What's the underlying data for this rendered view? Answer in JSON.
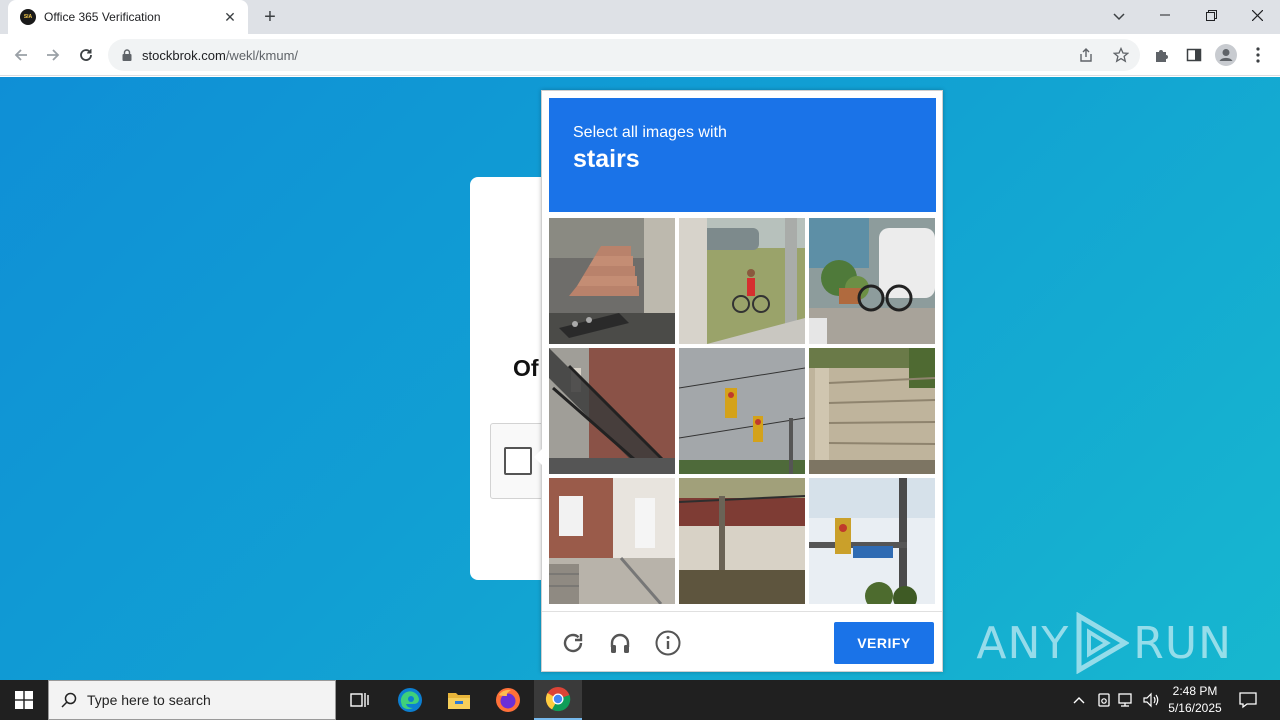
{
  "browser": {
    "tab": {
      "favicon_text": "SIA",
      "title": "Office 365 Verification",
      "close": "✕"
    },
    "new_tab": "+",
    "url": {
      "host": "stockbrok.com",
      "path": "/wekl/kmum/"
    }
  },
  "page": {
    "card_title": "Of"
  },
  "captcha": {
    "subtitle": "Select all images with",
    "target": "stairs",
    "tiles": [
      "stairs-tile",
      "child-bicycle-tile",
      "bicycle-plants-tile",
      "outdoor-stairs-tile",
      "traffic-light-tile",
      "fence-wall-tile",
      "house-steps-tile",
      "railing-wall-tile",
      "street-sign-tile"
    ],
    "verify_label": "VERIFY"
  },
  "watermark": {
    "left": "ANY",
    "right": "RUN"
  },
  "taskbar": {
    "search_placeholder": "Type here to search",
    "time": "2:48 PM",
    "date": "5/16/2025"
  },
  "colors": {
    "accent": "#1a73e8",
    "page_gradient_start": "#0f8fd6",
    "page_gradient_end": "#17b7cf"
  }
}
